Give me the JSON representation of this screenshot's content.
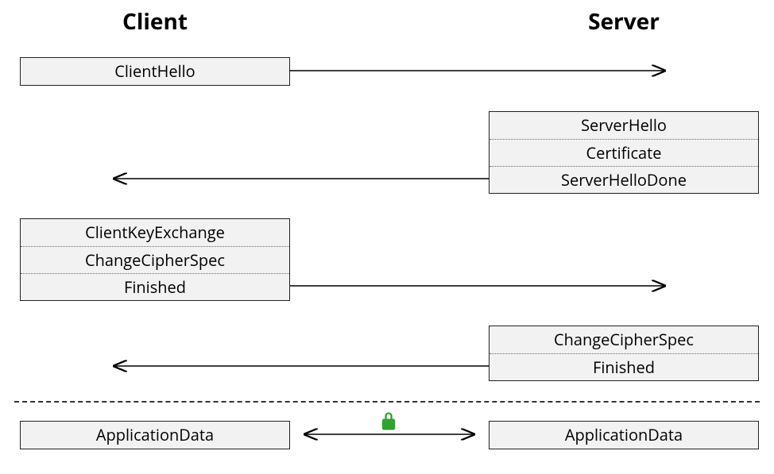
{
  "headers": {
    "client": "Client",
    "server": "Server"
  },
  "steps": {
    "c1": [
      "ClientHello"
    ],
    "s1": [
      "ServerHello",
      "Certificate",
      "ServerHelloDone"
    ],
    "c2": [
      "ClientKeyExchange",
      "ChangeCipherSpec",
      "Finished"
    ],
    "s2": [
      "ChangeCipherSpec",
      "Finished"
    ],
    "appc": [
      "ApplicationData"
    ],
    "apps": [
      "ApplicationData"
    ]
  },
  "icons": {
    "lock_name": "lock-icon"
  }
}
